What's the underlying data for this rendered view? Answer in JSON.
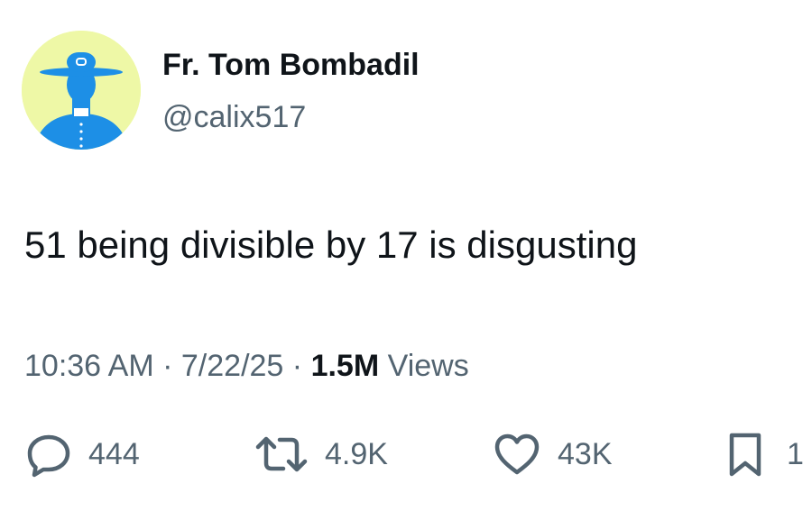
{
  "author": {
    "display_name": "Fr. Tom Bombadil",
    "handle": "@calix517",
    "avatar_icon": "priest-silhouette-avatar-icon"
  },
  "tweet": {
    "text": "51 being divisible by 17 is disgusting"
  },
  "meta": {
    "time": "10:36 AM",
    "separator": "·",
    "date": "7/22/25",
    "views_count": "1.5M",
    "views_label": "Views"
  },
  "actions": {
    "reply": {
      "icon": "reply-icon",
      "count": "444"
    },
    "repost": {
      "icon": "repost-icon",
      "count": "4.9K"
    },
    "like": {
      "icon": "heart-icon",
      "count": "43K"
    },
    "bookmark": {
      "icon": "bookmark-icon",
      "count": "1"
    }
  },
  "colors": {
    "text_primary": "#0f1419",
    "text_secondary": "#536471",
    "avatar_background": "#eef8a6",
    "avatar_figure": "#1d8fe6"
  }
}
